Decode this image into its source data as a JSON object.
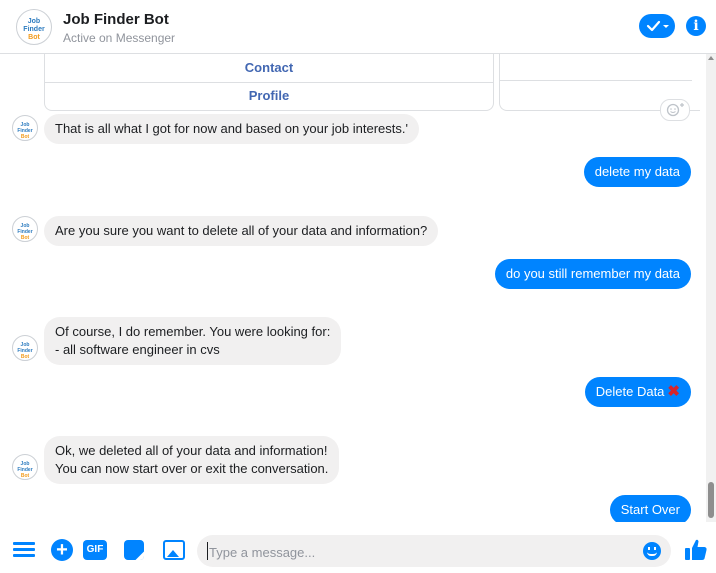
{
  "header": {
    "title": "Job Finder Bot",
    "status": "Active on Messenger",
    "avatar_line1": "Job Finder",
    "avatar_line2": "Bot"
  },
  "card": {
    "buttons": [
      "Contact",
      "Profile"
    ]
  },
  "messages": [
    {
      "from": "bot",
      "text": "That is all what I got for now and based on your job interests.'"
    },
    {
      "from": "user",
      "text": "delete my data"
    },
    {
      "from": "bot",
      "text": "Are you sure you want to delete all of your data and information?"
    },
    {
      "from": "user",
      "text": "do you still remember my data"
    },
    {
      "from": "bot",
      "text": "Of course, I do remember. You were looking for:\n- all software engineer in cvs"
    },
    {
      "from": "user",
      "text": "Delete Data",
      "emoji": "✖"
    },
    {
      "from": "bot",
      "text": "Ok, we deleted all of your data and information!\nYou can now start over or exit the conversation."
    },
    {
      "from": "user",
      "text": "Start Over"
    }
  ],
  "composer": {
    "placeholder": "Type a message...",
    "gif_label": "GIF"
  },
  "colors": {
    "accent": "#0084ff",
    "bubble_in": "#f1f0f0",
    "card_link": "#4267b2"
  }
}
